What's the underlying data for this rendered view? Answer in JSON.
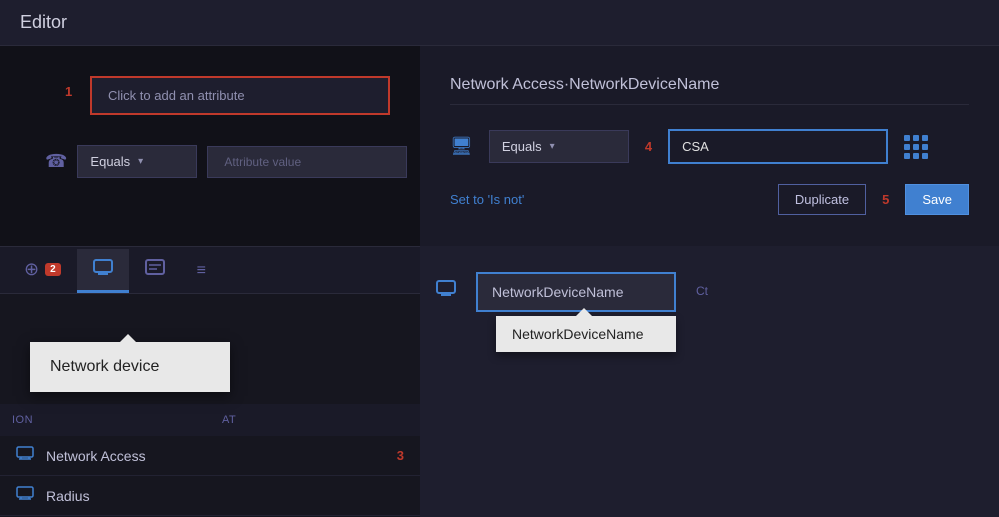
{
  "header": {
    "title": "Editor"
  },
  "top_left": {
    "badge1": "1",
    "add_attribute_placeholder": "Click to add an attribute",
    "equals_label": "Equals",
    "attribute_value_placeholder": "Attribute value"
  },
  "top_right": {
    "title": "Network Access·NetworkDeviceName",
    "equals_label": "Equals",
    "badge4": "4",
    "csa_value": "CSA",
    "set_is_not": "Set to 'Is not'",
    "duplicate_label": "Duplicate",
    "badge5": "5",
    "save_label": "Save"
  },
  "tabs": [
    {
      "id": "globe",
      "icon": "⊕",
      "badge": "2",
      "active": false
    },
    {
      "id": "monitor",
      "icon": "⊡",
      "active": true
    },
    {
      "id": "id-card",
      "icon": "⊟",
      "active": false
    },
    {
      "id": "note",
      "icon": "≡",
      "active": false
    }
  ],
  "tooltip_network_device": {
    "label": "Network device"
  },
  "column_headers": {
    "left": "ion",
    "right": "At"
  },
  "list_items": [
    {
      "icon": "monitor",
      "label": "Network Access",
      "badge": "3"
    },
    {
      "icon": "monitor",
      "label": "Radius",
      "badge": ""
    }
  ],
  "dropdown_popup": {
    "main_label": "NetworkDeviceName",
    "option_label": "NetworkDeviceName",
    "col_label": "Ct"
  }
}
